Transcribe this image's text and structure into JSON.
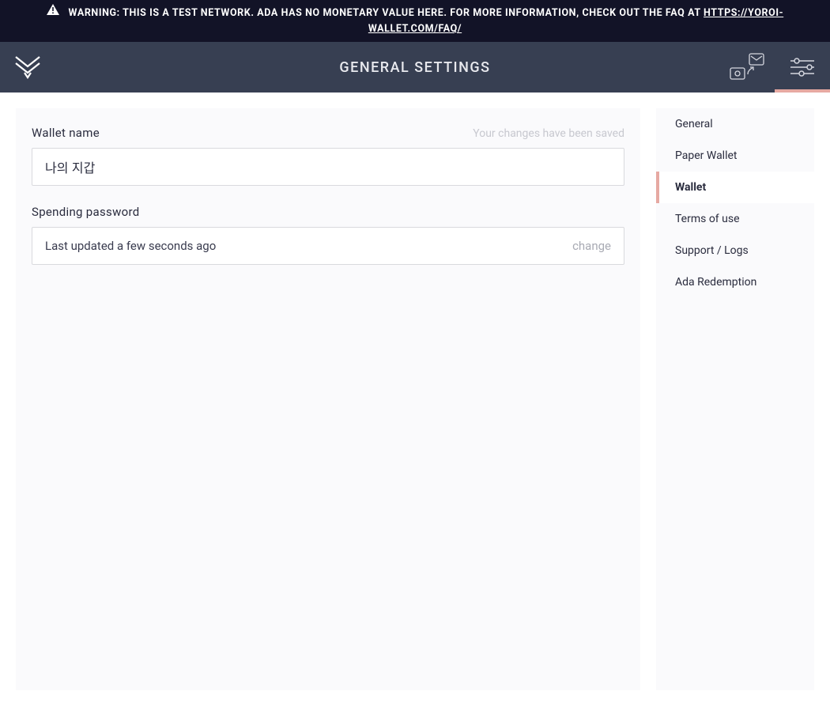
{
  "warning": {
    "text": "WARNING: THIS IS A TEST NETWORK. ADA HAS NO MONETARY VALUE HERE. FOR MORE INFORMATION, CHECK OUT THE FAQ AT ",
    "link_text": "HTTPS://YOROI-WALLET.COM/FAQ/"
  },
  "navbar": {
    "title": "GENERAL SETTINGS"
  },
  "form": {
    "wallet_name_label": "Wallet name",
    "wallet_name_value": "나의 지갑",
    "saved_message": "Your changes have been saved",
    "spending_password_label": "Spending password",
    "spending_password_status": "Last updated a few seconds ago",
    "change_label": "change"
  },
  "sidebar": {
    "items": [
      "General",
      "Paper Wallet",
      "Wallet",
      "Terms of use",
      "Support / Logs",
      "Ada Redemption"
    ],
    "active_index": 2
  }
}
